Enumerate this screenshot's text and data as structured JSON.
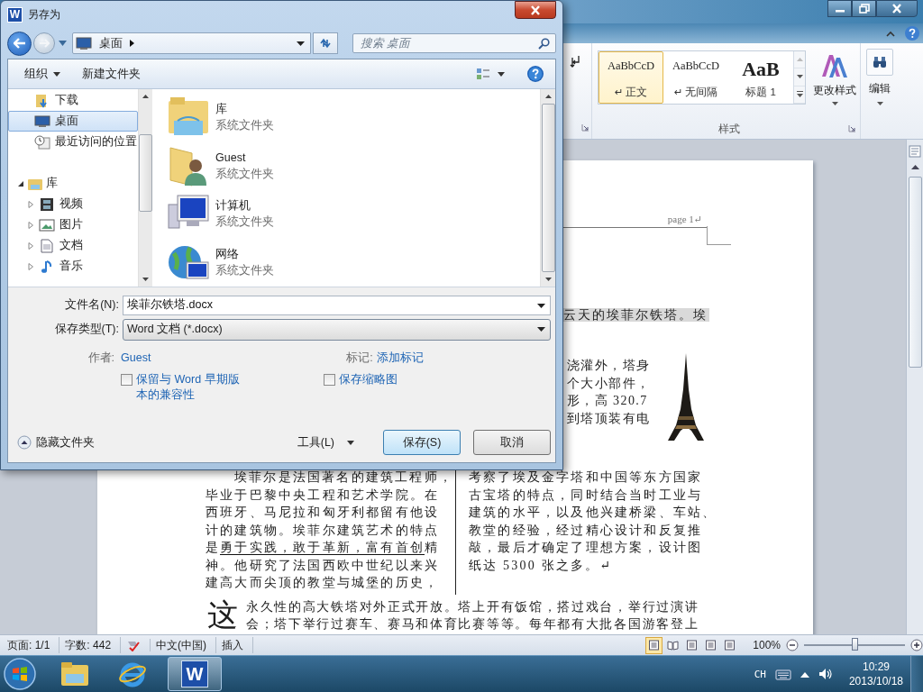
{
  "word": {
    "ribbon": {
      "styles": [
        {
          "preview": "AaBbCcD",
          "label": "↵ 正文",
          "kind": "normal",
          "selected": true
        },
        {
          "preview": "AaBbCcD",
          "label": "↵ 无间隔",
          "kind": "normal",
          "selected": false
        },
        {
          "preview": "AaB",
          "label": "标题 1",
          "kind": "heading",
          "selected": false
        }
      ],
      "change_styles": "更改样式",
      "styles_group": "样式",
      "editing": "编辑"
    },
    "document": {
      "header": "page 1↵",
      "highlighted_line": "云天的埃菲尔铁塔。埃",
      "wrap_lines": [
        "浇灌外，塔身",
        "个大小部件，",
        "形，高 320.7",
        "到塔顶装有电"
      ],
      "left_column": [
        [
          {
            "text": "埃菲尔是法国著名的建筑工程师，",
            "underline": false
          }
        ],
        [
          {
            "text": "毕业于巴黎中央工程和艺术学院。在",
            "underline": false
          }
        ],
        [
          {
            "text": "西班牙、马尼拉和匈牙利都留有他设",
            "underline": false
          }
        ],
        [
          {
            "text": "计的建筑物。埃菲尔建筑艺术的特点",
            "underline": false
          }
        ],
        [
          {
            "text": "是",
            "underline": false
          },
          {
            "text": "勇于实践，敢于革新，富有首创",
            "underline": true
          },
          {
            "text": "精",
            "underline": false
          }
        ],
        [
          {
            "text": "神。他研究了法国西欧中世纪以来兴",
            "underline": false
          }
        ],
        [
          {
            "text": "建高大而尖顶的教堂与城堡的历史，",
            "underline": false
          }
        ]
      ],
      "right_column": [
        "考察了埃及金字塔和中国等东方国家",
        "古宝塔的特点，同时结合当时工业与",
        "建筑的水平，以及他兴建桥梁、车站、",
        "教堂的经验，经过精心设计和反复推",
        "敲，最后才确定了理想方案，设计图",
        "纸达 5300 张之多。↵"
      ],
      "drop_cap": "这",
      "drop_cap_lines": [
        "永久性的高大铁塔对外正式开放。塔上开有饭馆，搭过戏台，举行过演讲",
        "会；塔下举行过赛车、赛马和体育比赛等等。每年都有大批各国游客登上"
      ]
    },
    "status_bar": {
      "page": "页面: 1/1",
      "words": "字数: 442",
      "language": "中文(中国)",
      "mode": "插入",
      "views": [
        {
          "kind": "print",
          "selected": true
        },
        {
          "kind": "reading",
          "selected": false
        },
        {
          "kind": "web",
          "selected": false
        },
        {
          "kind": "outline",
          "selected": false
        },
        {
          "kind": "draft",
          "selected": false
        }
      ],
      "zoom": "100%",
      "zoom_slider": {
        "level": 0.5
      }
    }
  },
  "dialog": {
    "title_icon": "W",
    "title": "另存为",
    "address": "桌面",
    "search": {
      "placeholder": "搜索 桌面"
    },
    "toolbar": {
      "organize": "组织",
      "new_folder": "新建文件夹"
    },
    "nav_pane": [
      {
        "label": "下载",
        "kind": "downloads",
        "selected": false
      },
      {
        "label": "桌面",
        "kind": "desktop",
        "selected": true
      },
      {
        "label": "最近访问的位置",
        "kind": "recent",
        "selected": false
      },
      {
        "label": "库",
        "kind": "library",
        "selected": false,
        "expanded": true,
        "children": [
          {
            "label": "视频",
            "kind": "video",
            "selected": false,
            "expanded": false
          },
          {
            "label": "图片",
            "kind": "pictures",
            "selected": false,
            "expanded": false
          },
          {
            "label": "文档",
            "kind": "documents",
            "selected": false,
            "expanded": false
          },
          {
            "label": "音乐",
            "kind": "music",
            "selected": false,
            "expanded": false
          }
        ]
      }
    ],
    "files": [
      {
        "name": "库",
        "type": "系统文件夹",
        "kind": "library"
      },
      {
        "name": "Guest",
        "type": "系统文件夹",
        "kind": "user"
      },
      {
        "name": "计算机",
        "type": "系统文件夹",
        "kind": "computer"
      },
      {
        "name": "网络",
        "type": "系统文件夹",
        "kind": "network"
      }
    ],
    "file_name": {
      "label": "文件名(N):",
      "value": "埃菲尔铁塔.docx"
    },
    "file_type": {
      "label": "保存类型(T):",
      "value": "Word 文档 (*.docx)"
    },
    "author": {
      "label": "作者:",
      "value": "Guest"
    },
    "tags": {
      "label": "标记:",
      "value": "添加标记"
    },
    "options": [
      {
        "label": "保留与 Word 早期版本的兼容性",
        "checked": false
      },
      {
        "label": "保存缩略图",
        "checked": false
      }
    ],
    "hide_folders": "隐藏文件夹",
    "tools": "工具(L)",
    "buttons": [
      {
        "label": "保存(S)",
        "kind": "primary"
      },
      {
        "label": "取消",
        "kind": "secondary"
      }
    ]
  },
  "taskbar": {
    "apps": [
      {
        "kind": "explorer",
        "selected": false
      },
      {
        "kind": "browser",
        "selected": false
      },
      {
        "kind": "word",
        "selected": true,
        "icon_text": "W"
      }
    ],
    "tray": {
      "language": "CH",
      "time": "10:29",
      "date": "2013/10/18"
    }
  }
}
